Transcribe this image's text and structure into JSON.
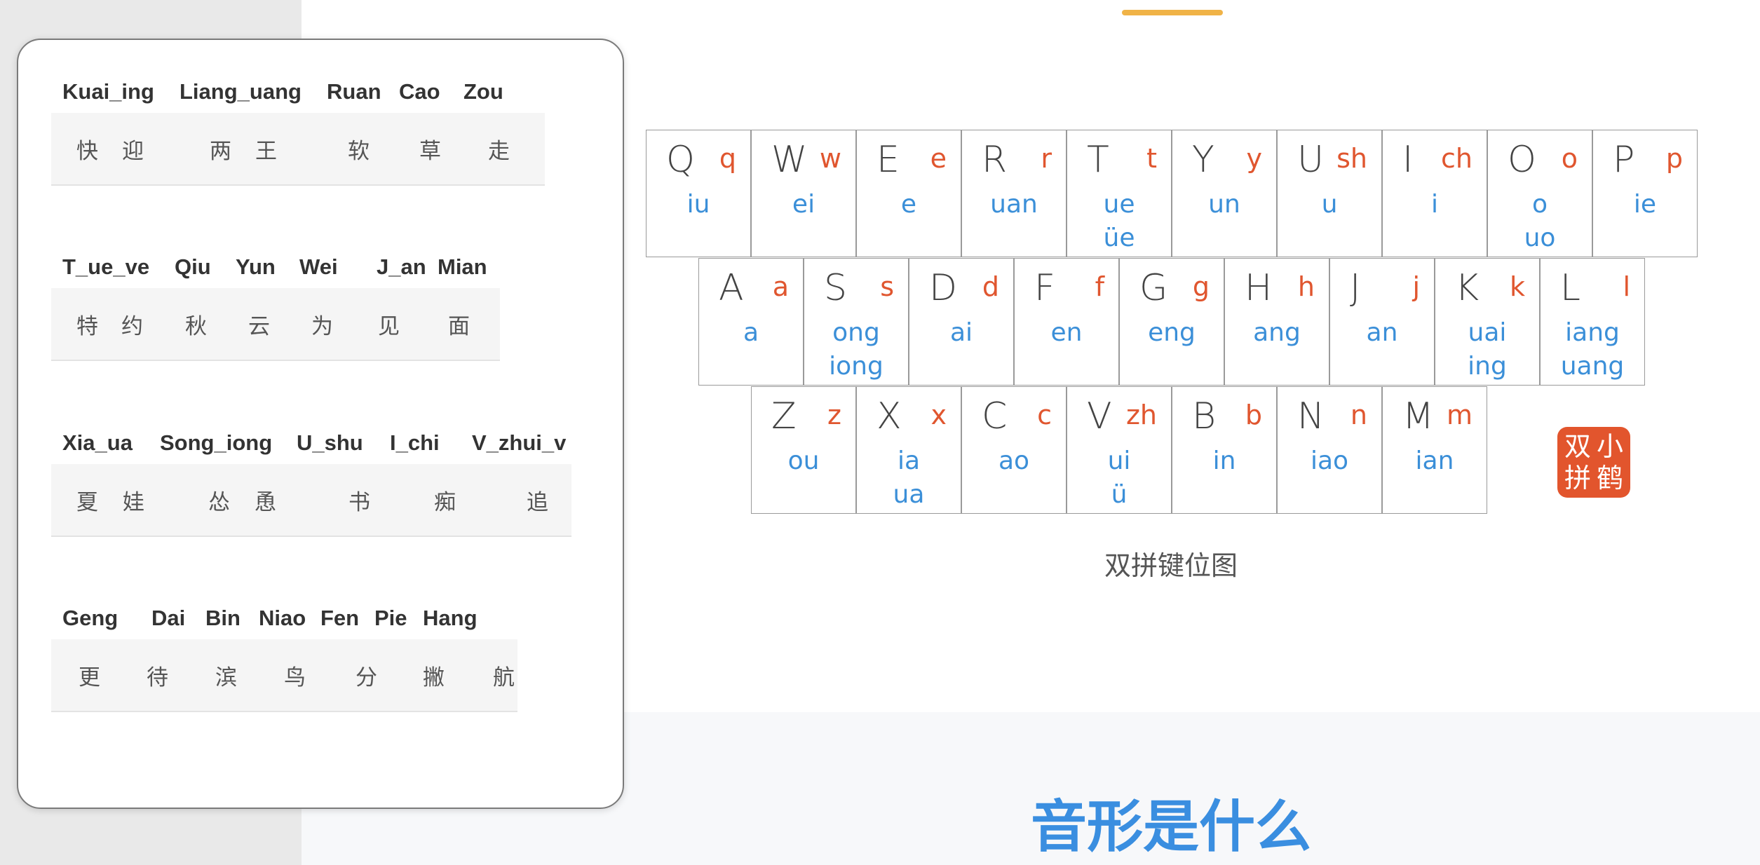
{
  "popup": {
    "groups": [
      {
        "header": [
          "Kuai_ing",
          "Liang_uang",
          "Ruan",
          "Cao",
          "Zou"
        ],
        "cells": [
          "快",
          "迎",
          "两",
          "王",
          "软",
          "草",
          "走"
        ]
      },
      {
        "header": [
          "T_ue_ve",
          "Qiu",
          "Yun",
          "Wei",
          "J_an",
          "Mian"
        ],
        "cells": [
          "特",
          "约",
          "秋",
          "云",
          "为",
          "见",
          "面"
        ]
      },
      {
        "header": [
          "Xia_ua",
          "Song_iong",
          "U_shu",
          "I_chi",
          "V_zhui_v"
        ],
        "cells": [
          "夏",
          "娃",
          "怂",
          "恿",
          "书",
          "痴",
          "追"
        ]
      },
      {
        "header": [
          "Geng",
          "Dai",
          "Bin",
          "Niao",
          "Fen",
          "Pie",
          "Hang"
        ],
        "cells": [
          "更",
          "待",
          "滨",
          "鸟",
          "分",
          "撇",
          "航"
        ]
      }
    ]
  },
  "keyboard": {
    "rows": [
      [
        {
          "key": "Q",
          "shengmu": "q",
          "yunmu": [
            "iu"
          ]
        },
        {
          "key": "W",
          "shengmu": "w",
          "yunmu": [
            "ei"
          ]
        },
        {
          "key": "E",
          "shengmu": "e",
          "yunmu": [
            "e"
          ]
        },
        {
          "key": "R",
          "shengmu": "r",
          "yunmu": [
            "uan"
          ]
        },
        {
          "key": "T",
          "shengmu": "t",
          "yunmu": [
            "ue",
            "üe"
          ]
        },
        {
          "key": "Y",
          "shengmu": "y",
          "yunmu": [
            "un"
          ]
        },
        {
          "key": "U",
          "shengmu": "sh",
          "yunmu": [
            "u"
          ]
        },
        {
          "key": "I",
          "shengmu": "ch",
          "yunmu": [
            "i"
          ]
        },
        {
          "key": "O",
          "shengmu": "o",
          "yunmu": [
            "o",
            "uo"
          ]
        },
        {
          "key": "P",
          "shengmu": "p",
          "yunmu": [
            "ie"
          ]
        }
      ],
      [
        {
          "key": "A",
          "shengmu": "a",
          "yunmu": [
            "a"
          ]
        },
        {
          "key": "S",
          "shengmu": "s",
          "yunmu": [
            "ong",
            "iong"
          ]
        },
        {
          "key": "D",
          "shengmu": "d",
          "yunmu": [
            "ai"
          ]
        },
        {
          "key": "F",
          "shengmu": "f",
          "yunmu": [
            "en"
          ]
        },
        {
          "key": "G",
          "shengmu": "g",
          "yunmu": [
            "eng"
          ]
        },
        {
          "key": "H",
          "shengmu": "h",
          "yunmu": [
            "ang"
          ]
        },
        {
          "key": "J",
          "shengmu": "j",
          "yunmu": [
            "an"
          ]
        },
        {
          "key": "K",
          "shengmu": "k",
          "yunmu": [
            "uai",
            "ing"
          ]
        },
        {
          "key": "L",
          "shengmu": "l",
          "yunmu": [
            "iang",
            "uang"
          ]
        }
      ],
      [
        {
          "key": "Z",
          "shengmu": "z",
          "yunmu": [
            "ou"
          ]
        },
        {
          "key": "X",
          "shengmu": "x",
          "yunmu": [
            "ia",
            "ua"
          ]
        },
        {
          "key": "C",
          "shengmu": "c",
          "yunmu": [
            "ao"
          ]
        },
        {
          "key": "V",
          "shengmu": "zh",
          "yunmu": [
            "ui",
            "ü"
          ]
        },
        {
          "key": "B",
          "shengmu": "b",
          "yunmu": [
            "in"
          ]
        },
        {
          "key": "N",
          "shengmu": "n",
          "yunmu": [
            "iao"
          ]
        },
        {
          "key": "M",
          "shengmu": "m",
          "yunmu": [
            "ian"
          ]
        }
      ]
    ],
    "seal": [
      "双",
      "小",
      "拼",
      "鹤"
    ],
    "caption": "双拼键位图"
  },
  "section": {
    "title": "音形是什么"
  },
  "colors": {
    "accent": "#f0b347",
    "shengmu": "#e0562f",
    "yunmu": "#3b8fd8",
    "title": "#3a8ee0"
  }
}
